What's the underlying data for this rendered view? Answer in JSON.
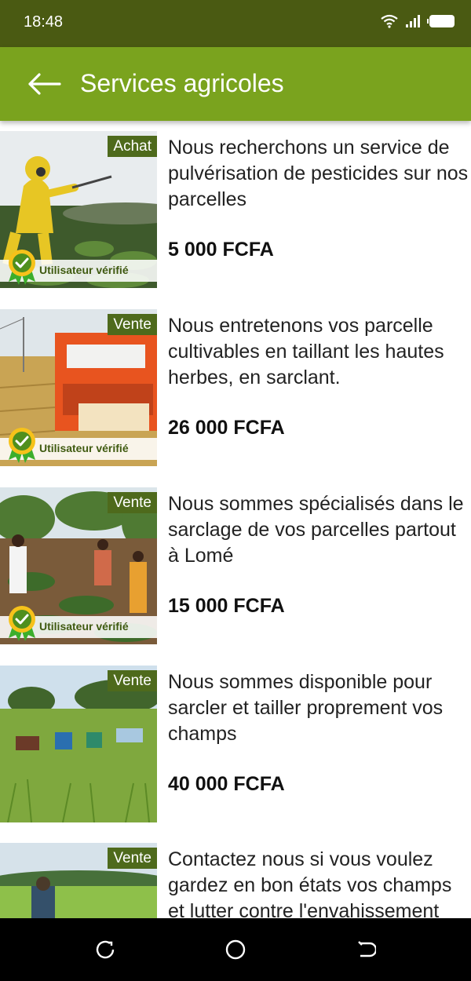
{
  "status_bar": {
    "time": "18:48"
  },
  "app_bar": {
    "title": "Services agricoles"
  },
  "verified_label": "Utilisateur vérifié",
  "listings": [
    {
      "type": "Achat",
      "description": "Nous recherchons un service de pulvérisation de pesticides sur nos parcelles",
      "price": "5 000 FCFA",
      "verified": true
    },
    {
      "type": "Vente",
      "description": "Nous entretenons vos parcelle cultivables en taillant les hautes herbes, en sarclant.",
      "price": "26 000 FCFA",
      "verified": true
    },
    {
      "type": "Vente",
      "description": "Nous sommes spécialisés dans le sarclage de vos parcelles partout à Lomé",
      "price": "15 000 FCFA",
      "verified": true
    },
    {
      "type": "Vente",
      "description": "Nous sommes disponible pour sarcler et tailler proprement vos champs",
      "price": "40 000 FCFA",
      "verified": false
    },
    {
      "type": "Vente",
      "description": "Contactez nous si vous voulez gardez en bon états vos champs et lutter contre l'envahissement",
      "price": "",
      "verified": false
    }
  ],
  "colors": {
    "status_bar": "#4a5a12",
    "app_bar": "#7aa31e",
    "badge": "#4e6a1c",
    "verified_text": "#3f5a10",
    "nav_bar": "#000000"
  },
  "icons": {
    "back": "arrow-left-icon",
    "wifi": "wifi-icon",
    "signal": "signal-icon",
    "battery": "battery-icon",
    "verified": "verified-medal-icon",
    "nav_recents": "recents-icon",
    "nav_home": "home-icon",
    "nav_back": "back-nav-icon"
  }
}
